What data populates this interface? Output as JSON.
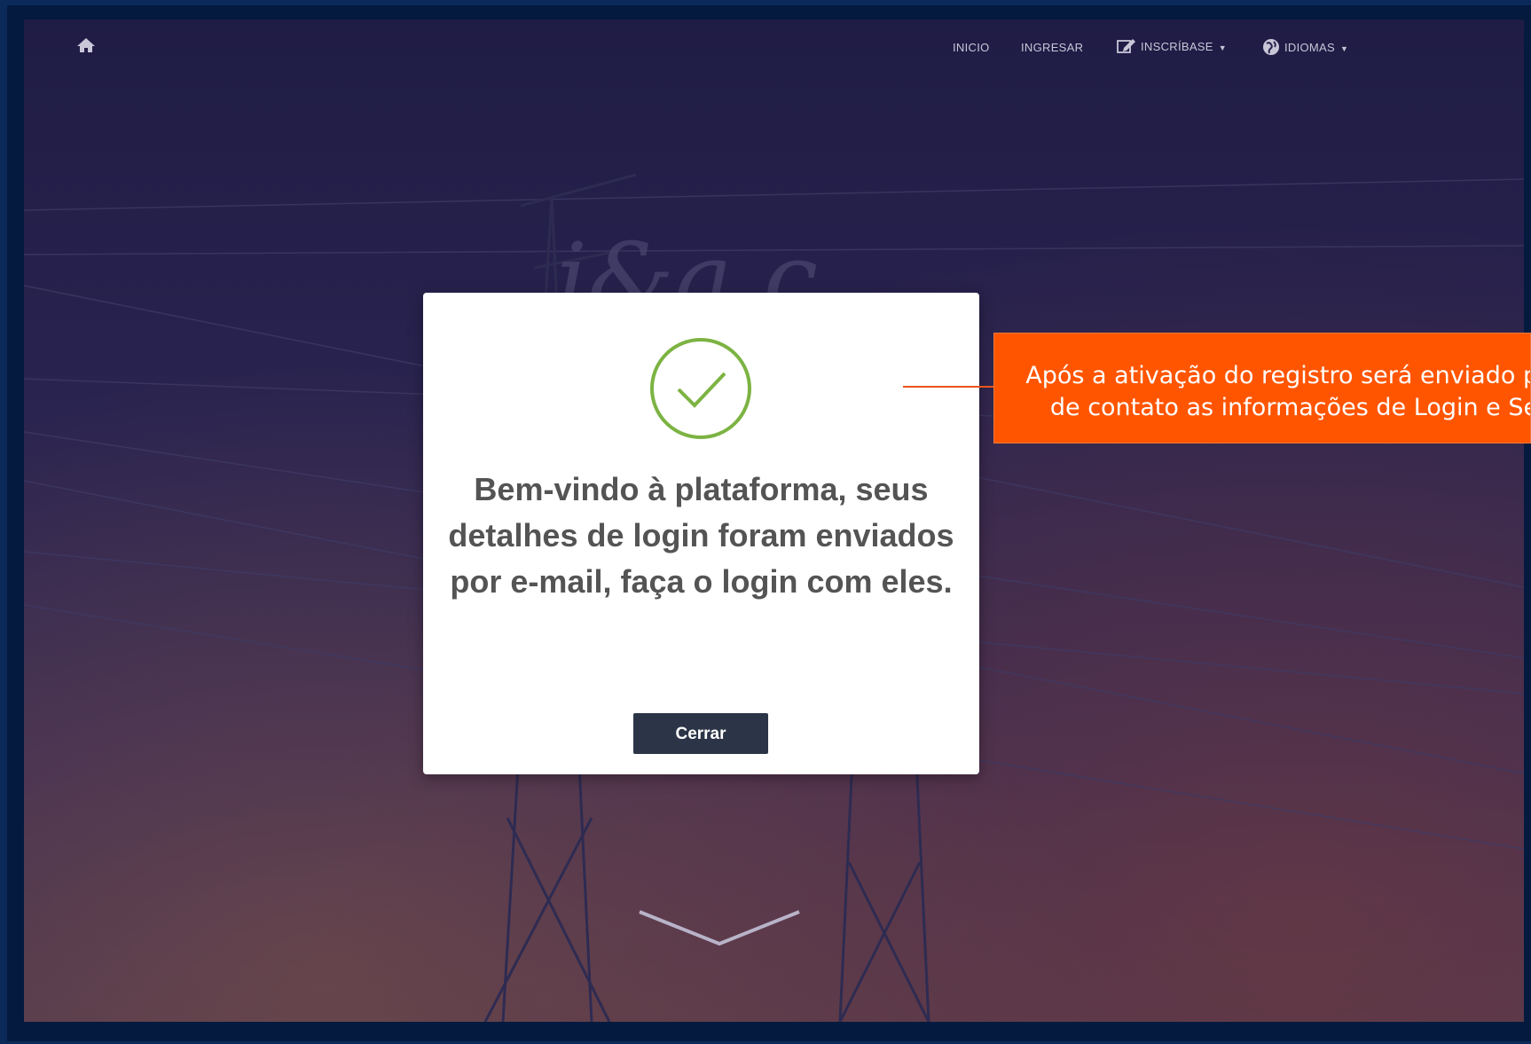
{
  "nav": {
    "home_icon": "home-icon",
    "items": [
      {
        "label": "INICIO"
      },
      {
        "label": "INGRESAR"
      },
      {
        "label": "INSCRÍBASE",
        "icon": "edit-icon",
        "has_caret": true
      },
      {
        "label": "IDIOMAS",
        "icon": "globe-icon",
        "has_caret": true
      }
    ]
  },
  "modal": {
    "icon": "check-circle-icon",
    "message": "Bem-vindo à plataforma, seus detalhes de login foram enviados por e-mail, faça o login com eles.",
    "close_label": "Cerrar"
  },
  "callout": {
    "line1": "Após a ativação do registro será enviado par",
    "line2": "de contato as informações de Login e Se"
  },
  "scroll_icon": "chevron-down-icon",
  "colors": {
    "check_green": "#7cb342",
    "button_bg": "#2b3547",
    "callout_bg": "#ff5500",
    "frame_border": "#0b2a5a"
  }
}
